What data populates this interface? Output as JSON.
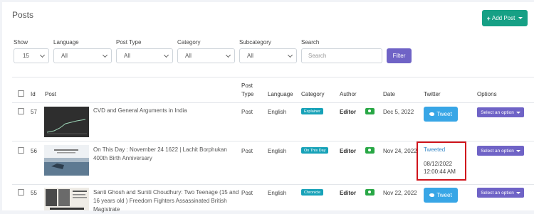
{
  "page": {
    "title": "Posts",
    "add_button": "Add Post"
  },
  "filters": {
    "show": {
      "label": "Show",
      "value": "15"
    },
    "language": {
      "label": "Language",
      "value": "All"
    },
    "post_type": {
      "label": "Post Type",
      "value": "All"
    },
    "category": {
      "label": "Category",
      "value": "All"
    },
    "subcategory": {
      "label": "Subcategory",
      "value": "All"
    },
    "search": {
      "label": "Search",
      "placeholder": "Search"
    },
    "filter_button": "Filter"
  },
  "table": {
    "headers": {
      "id": "Id",
      "post": "Post",
      "post_type_1": "Post",
      "post_type_2": "Type",
      "language": "Language",
      "category": "Category",
      "author": "Author",
      "date": "Date",
      "twitter": "Twitter",
      "options": "Options"
    },
    "rows": [
      {
        "id": "57",
        "title": "CVD and General Arguments in India",
        "post_type": "Post",
        "language": "English",
        "category": "Explainer",
        "author": "Editor",
        "date": "Dec 5, 2022",
        "twitter_action": "Tweet",
        "options": "Select an option"
      },
      {
        "id": "56",
        "title": "On This Day : November 24 1622 | Lachit Borphukan 400th Birth Anniversary",
        "post_type": "Post",
        "language": "English",
        "category": "On This Day",
        "author": "Editor",
        "date": "Nov 24, 2022",
        "twitter_status": "Tweeted",
        "twitter_date": "08/12/2022",
        "twitter_time": "12:00:44 AM",
        "options": "Select an option"
      },
      {
        "id": "55",
        "title": "Santi Ghosh and Suniti Choudhury: Two Teenage (15 and 16 years old ) Freedom Fighters Assassinated British Magistrate",
        "post_type": "Post",
        "language": "English",
        "category": "Chronicle",
        "author": "Editor",
        "date": "Nov 22, 2022",
        "twitter_action": "Tweet",
        "options": "Select an option"
      }
    ]
  },
  "colors": {
    "add": "#16a085",
    "filter": "#6f63c6",
    "tweet": "#38a6e6",
    "badge": "#17a2b8",
    "highlight": "#d0141c"
  }
}
